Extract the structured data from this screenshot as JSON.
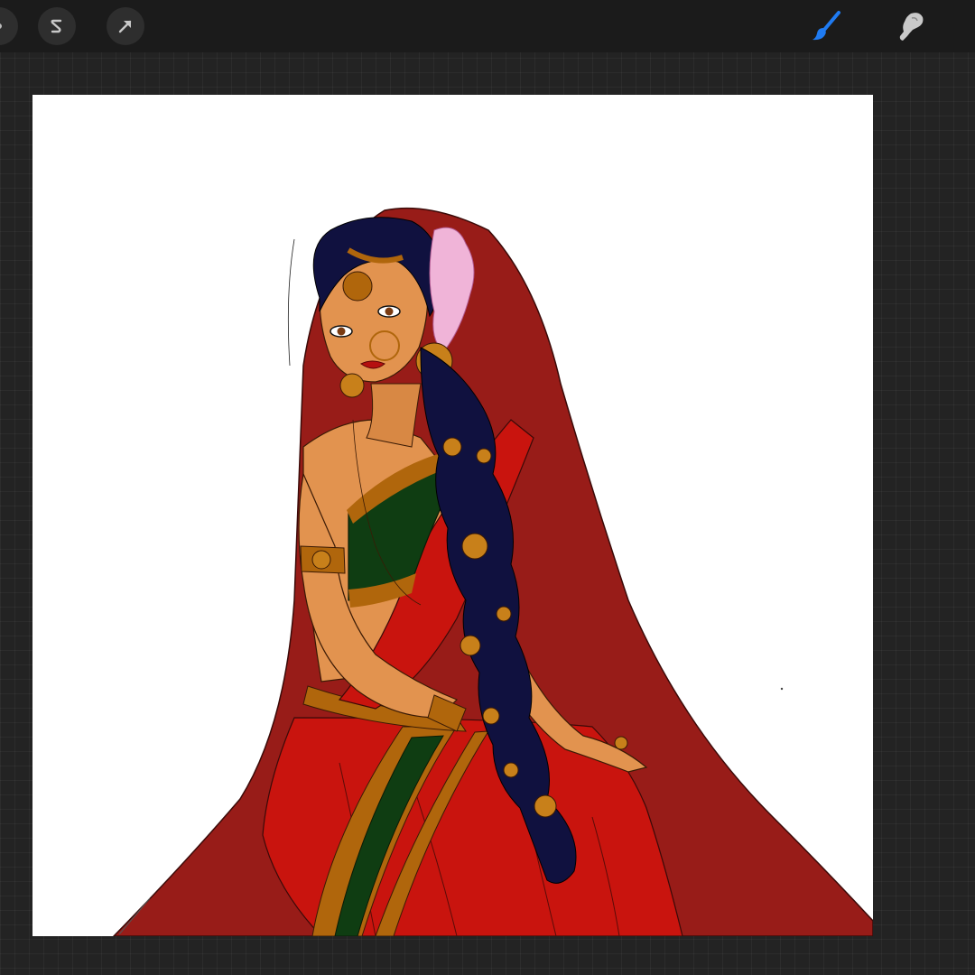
{
  "app": {
    "accent_color": "#1f7bf2",
    "toolbar": {
      "left_tools": [
        {
          "icon": "adjustments-icon"
        },
        {
          "icon": "selection-icon"
        },
        {
          "icon": "transform-arrow-icon"
        }
      ],
      "right_tools": [
        {
          "icon": "brush-icon",
          "active": true
        },
        {
          "icon": "smudge-icon",
          "active": false
        }
      ]
    },
    "canvas": {
      "background": "#ffffff",
      "artwork": "illustration-woman-in-red-saree"
    }
  }
}
